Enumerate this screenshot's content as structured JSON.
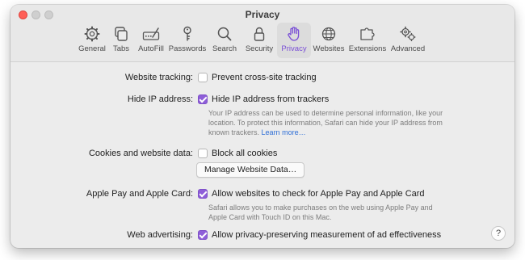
{
  "window": {
    "title": "Privacy"
  },
  "toolbar": {
    "items": [
      {
        "label": "General",
        "icon": "gear-icon"
      },
      {
        "label": "Tabs",
        "icon": "tabs-icon"
      },
      {
        "label": "AutoFill",
        "icon": "autofill-icon"
      },
      {
        "label": "Passwords",
        "icon": "key-icon"
      },
      {
        "label": "Search",
        "icon": "magnifier-icon"
      },
      {
        "label": "Security",
        "icon": "lock-icon"
      },
      {
        "label": "Privacy",
        "icon": "hand-icon",
        "active": true
      },
      {
        "label": "Websites",
        "icon": "globe-icon"
      },
      {
        "label": "Extensions",
        "icon": "puzzle-icon"
      },
      {
        "label": "Advanced",
        "icon": "gears-icon"
      }
    ],
    "accent_color": "#8e5ed8"
  },
  "settings": {
    "website_tracking": {
      "label": "Website tracking:",
      "option": "Prevent cross-site tracking",
      "checked": false
    },
    "hide_ip": {
      "label": "Hide IP address:",
      "option": "Hide IP address from trackers",
      "checked": true,
      "description": "Your IP address can be used to determine personal information, like your location. To protect this information, Safari can hide your IP address from known trackers.",
      "link": "Learn more…"
    },
    "cookies": {
      "label": "Cookies and website data:",
      "option": "Block all cookies",
      "checked": false,
      "button": "Manage Website Data…"
    },
    "apple_pay": {
      "label": "Apple Pay and Apple Card:",
      "option": "Allow websites to check for Apple Pay and Apple Card",
      "checked": true,
      "description": "Safari allows you to make purchases on the web using Apple Pay and Apple Card with Touch ID on this Mac."
    },
    "web_advertising": {
      "label": "Web advertising:",
      "option": "Allow privacy-preserving measurement of ad effectiveness",
      "checked": true
    }
  },
  "help": {
    "label": "?"
  }
}
